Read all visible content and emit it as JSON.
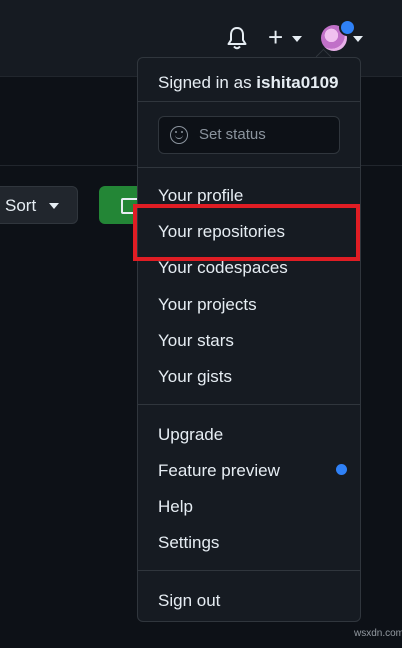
{
  "header": {
    "icons": [
      "bell-icon",
      "plus-icon",
      "avatar"
    ],
    "avatar_notification": true
  },
  "toolbar": {
    "sort_label": "Sort",
    "new_button_icon": "repo-icon",
    "new_button_color": "#238636"
  },
  "menu": {
    "signed_in_prefix": "Signed in as ",
    "username": "ishita0109",
    "status": {
      "icon": "smiley-icon",
      "label": "Set status"
    },
    "items": [
      {
        "label": "Your profile"
      },
      {
        "label": "Your repositories",
        "highlighted": true
      },
      {
        "label": "Your codespaces"
      },
      {
        "label": "Your projects"
      },
      {
        "label": "Your stars"
      },
      {
        "label": "Your gists"
      }
    ],
    "secondary": [
      {
        "label": "Upgrade"
      },
      {
        "label": "Feature preview",
        "badge": "blue-dot"
      },
      {
        "label": "Help"
      },
      {
        "label": "Settings"
      }
    ],
    "sign_out": "Sign out"
  },
  "colors": {
    "background": "#0d1117",
    "menu_background": "#161b22",
    "highlight_border": "#e01d24",
    "accent_blue": "#2f81f7"
  },
  "watermark": "wsxdn.com"
}
